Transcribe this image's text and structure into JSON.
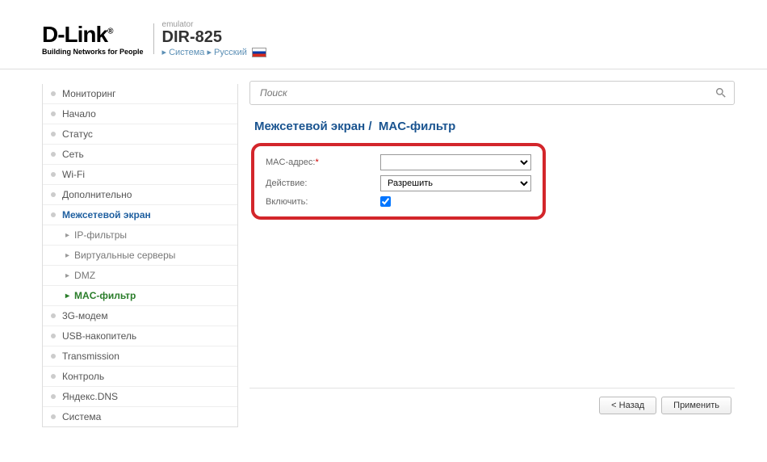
{
  "header": {
    "logo_main": "D-Link",
    "logo_sub": "Building Networks for People",
    "emulator": "emulator",
    "product": "DIR-825",
    "bc_system": "Система",
    "bc_lang": "Русский"
  },
  "sidebar": {
    "items": [
      {
        "label": "Мониторинг"
      },
      {
        "label": "Начало"
      },
      {
        "label": "Статус"
      },
      {
        "label": "Сеть"
      },
      {
        "label": "Wi-Fi"
      },
      {
        "label": "Дополнительно"
      },
      {
        "label": "Межсетевой экран",
        "active": true,
        "subs": [
          {
            "label": "IP-фильтры"
          },
          {
            "label": "Виртуальные серверы"
          },
          {
            "label": "DMZ"
          },
          {
            "label": "MAC-фильтр",
            "active": true
          }
        ]
      },
      {
        "label": "3G-модем"
      },
      {
        "label": "USB-накопитель"
      },
      {
        "label": "Transmission"
      },
      {
        "label": "Контроль"
      },
      {
        "label": "Яндекс.DNS"
      },
      {
        "label": "Система"
      }
    ]
  },
  "search": {
    "placeholder": "Поиск"
  },
  "page": {
    "title_a": "Межсетевой экран",
    "sep": "/",
    "title_b": "MAC-фильтр"
  },
  "form": {
    "mac_label": "MAC-адрес:",
    "mac_value": "",
    "action_label": "Действие:",
    "action_value": "Разрешить",
    "enable_label": "Включить:",
    "enable_checked": true
  },
  "buttons": {
    "back": "< Назад",
    "apply": "Применить"
  }
}
